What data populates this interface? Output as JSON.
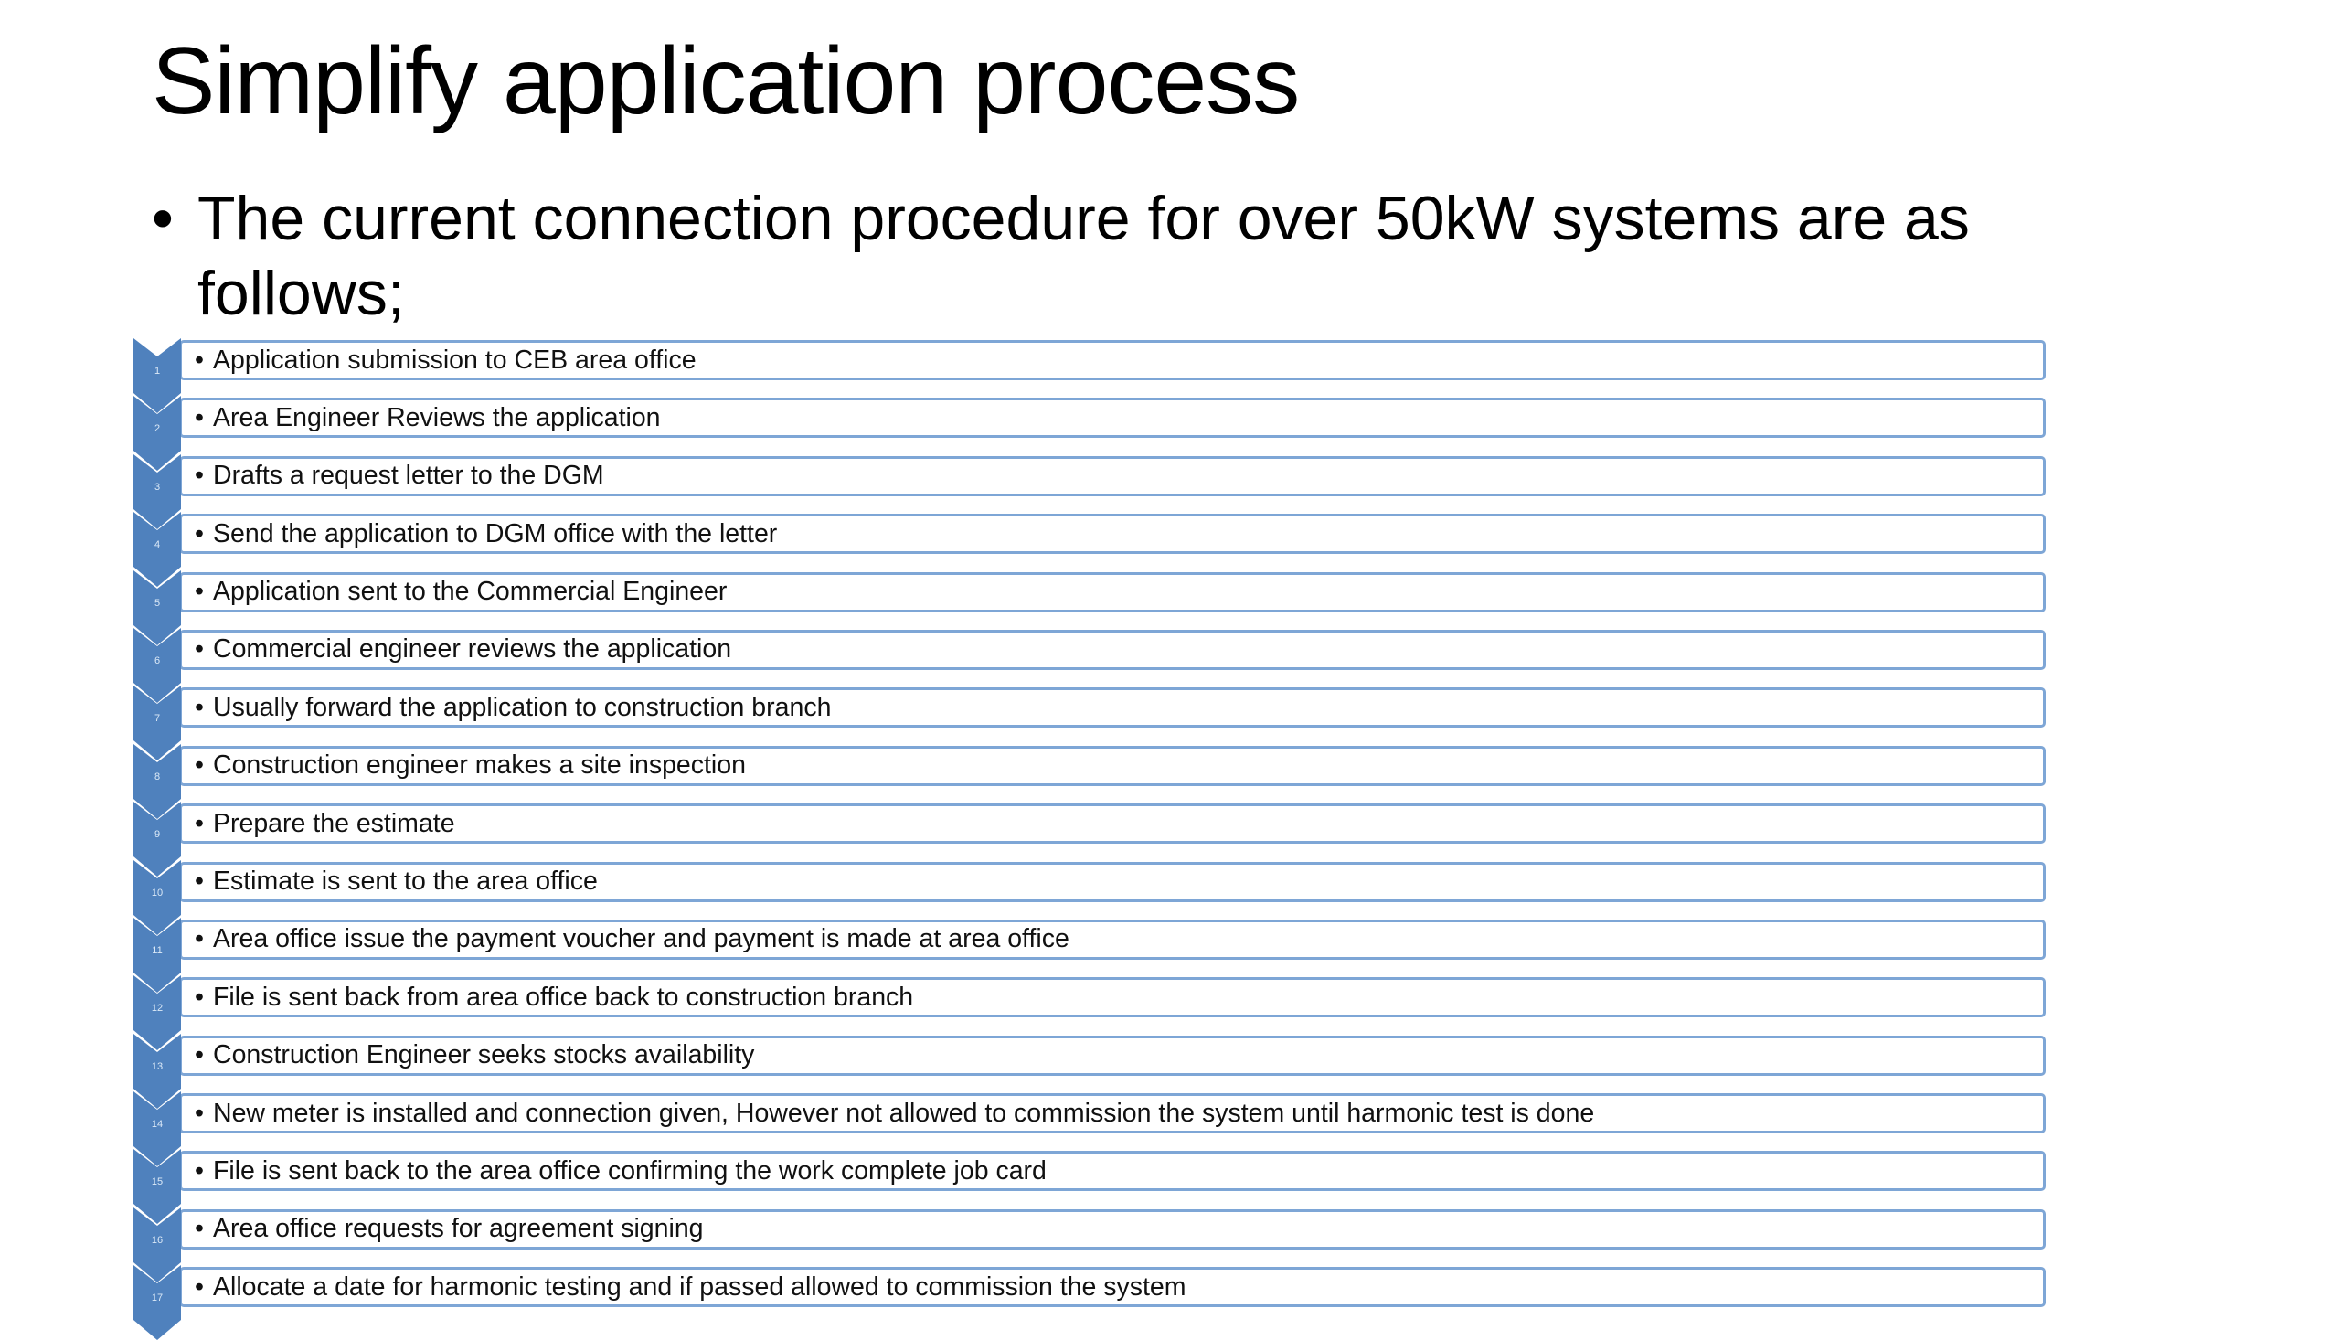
{
  "slide": {
    "title": "Simplify application process",
    "intro_bullet": "•",
    "intro_text": "The current connection procedure for over 50kW systems are as follows;",
    "step_bullet": "•",
    "accent_color": "#4f81bd",
    "box_border_color": "#7ea6d6",
    "steps": [
      {
        "number": "1",
        "text": "Application submission to CEB area office"
      },
      {
        "number": "2",
        "text": "Area Engineer Reviews the application"
      },
      {
        "number": "3",
        "text": "Drafts a request letter to the DGM"
      },
      {
        "number": "4",
        "text": "Send the application to DGM office with the letter"
      },
      {
        "number": "5",
        "text": "Application sent to the Commercial Engineer"
      },
      {
        "number": "6",
        "text": "Commercial engineer reviews the application"
      },
      {
        "number": "7",
        "text": "Usually forward the application to construction branch"
      },
      {
        "number": "8",
        "text": "Construction engineer makes a site inspection"
      },
      {
        "number": "9",
        "text": "Prepare  the estimate"
      },
      {
        "number": "10",
        "text": "Estimate is sent to the area office"
      },
      {
        "number": "11",
        "text": "Area office issue the payment voucher and payment is made at area office"
      },
      {
        "number": "12",
        "text": "File is sent back from area office back to construction branch"
      },
      {
        "number": "13",
        "text": "Construction Engineer seeks stocks availability"
      },
      {
        "number": "14",
        "text": "New meter is installed and connection given, However not allowed to commission the system until harmonic test is done"
      },
      {
        "number": "15",
        "text": "File is sent back to the area office confirming the work complete job card"
      },
      {
        "number": "16",
        "text": "Area office requests for agreement signing"
      },
      {
        "number": "17",
        "text": "Allocate a date for harmonic testing and if passed allowed to commission the system"
      }
    ]
  }
}
